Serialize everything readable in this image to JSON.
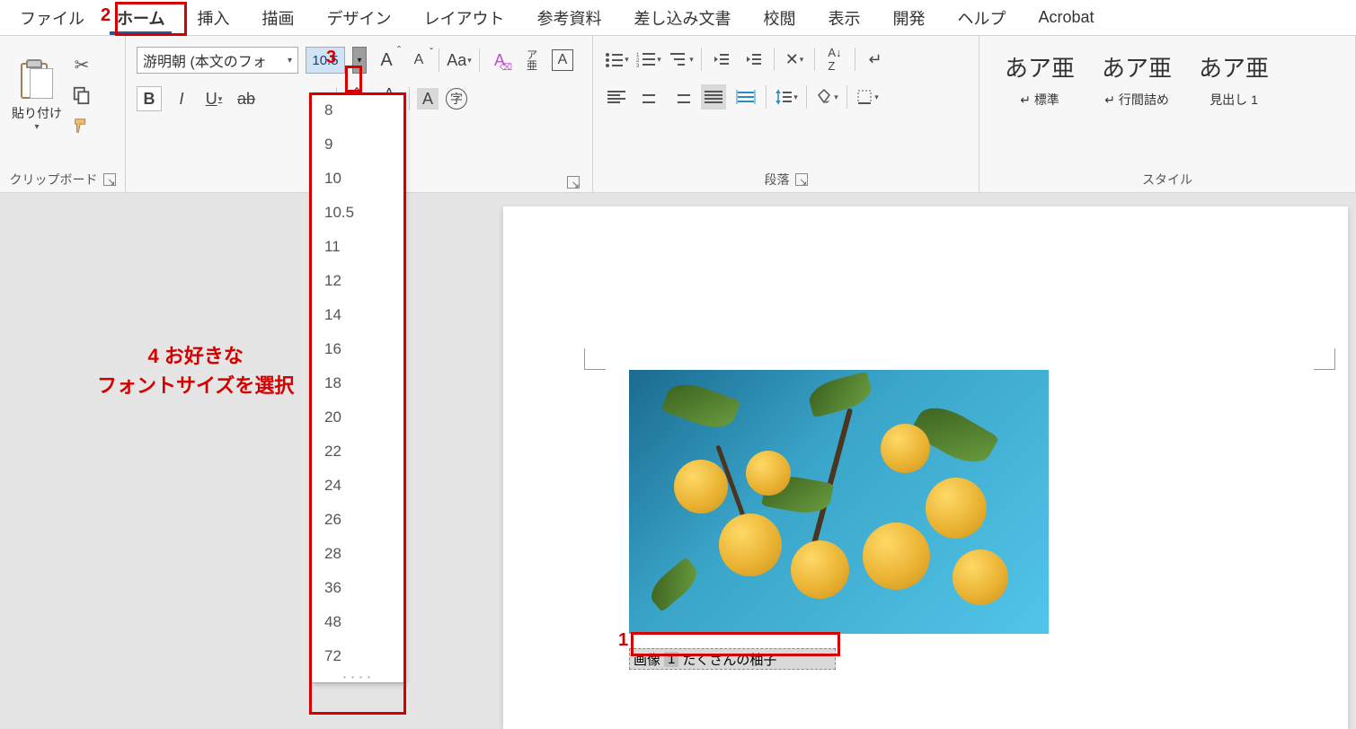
{
  "tabs": {
    "file": "ファイル",
    "home": "ホーム",
    "insert": "挿入",
    "draw": "描画",
    "design": "デザイン",
    "layout": "レイアウト",
    "references": "参考資料",
    "mailings": "差し込み文書",
    "review": "校閲",
    "view": "表示",
    "developer": "開発",
    "help": "ヘルプ",
    "acrobat": "Acrobat"
  },
  "clipboard": {
    "label": "クリップボード",
    "paste": "貼り付け"
  },
  "font": {
    "name": "游明朝 (本文のフォ",
    "size": "10.5",
    "sizes": [
      "8",
      "9",
      "10",
      "10.5",
      "11",
      "12",
      "14",
      "16",
      "18",
      "20",
      "22",
      "24",
      "26",
      "28",
      "36",
      "48",
      "72"
    ]
  },
  "paragraph": {
    "label": "段落"
  },
  "styles": {
    "label": "スタイル",
    "items": [
      {
        "sample": "あア亜",
        "name": "標準"
      },
      {
        "sample": "あア亜",
        "name": "行間詰め"
      },
      {
        "sample": "あア亜",
        "name": "見出し 1"
      }
    ]
  },
  "caption": {
    "prefix": "画像",
    "number": "1",
    "text": "たくさんの柚子"
  },
  "annotations": {
    "n1": "1",
    "n2": "2",
    "n3": "3",
    "n4_line1": "4 お好きな",
    "n4_line2": "フォントサイズを選択"
  }
}
